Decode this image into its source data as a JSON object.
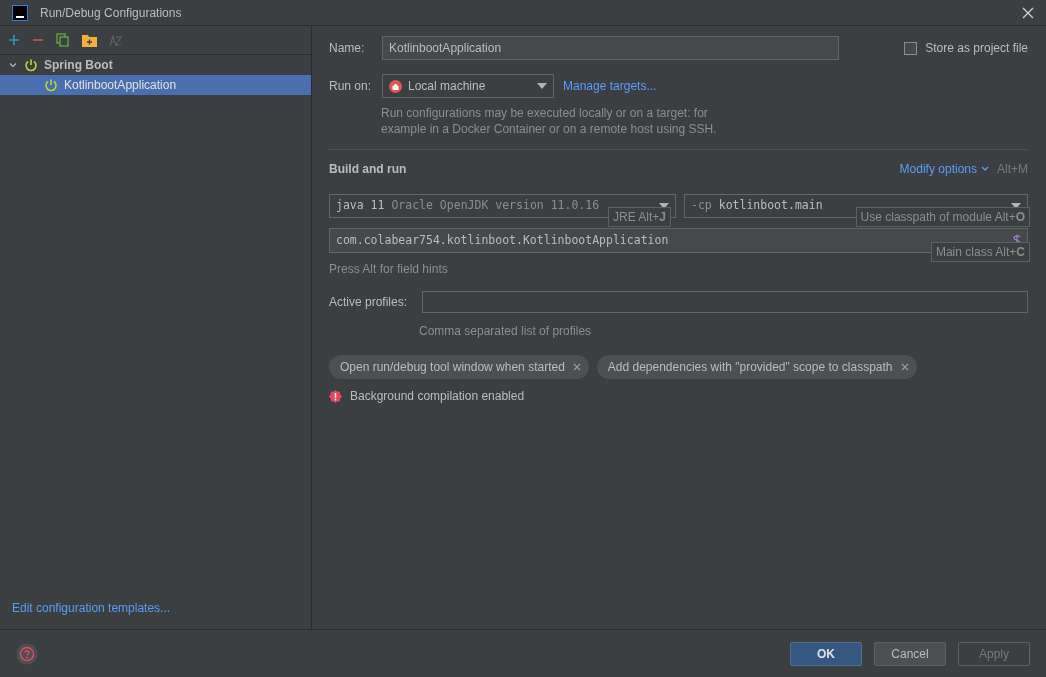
{
  "window": {
    "title": "Run/Debug Configurations"
  },
  "tree": [
    {
      "label": "Spring Boot",
      "expanded": true,
      "selected": false,
      "children": [
        {
          "label": "KotlinbootApplication",
          "selected": true
        }
      ]
    }
  ],
  "edit_templates_link": "Edit configuration templates...",
  "name": {
    "label": "Name:",
    "value": "KotlinbootApplication"
  },
  "store_as_project_file": {
    "label": "Store as project file",
    "checked": false
  },
  "run_on": {
    "label": "Run on:",
    "value": "Local machine",
    "link": "Manage targets..."
  },
  "run_on_help": "Run configurations may be executed locally or on a target: for example in a Docker Container or on a remote host using SSH.",
  "section_title": "Build and run",
  "modify_options": {
    "label": "Modify options",
    "shortcut": "Alt+M"
  },
  "jre": {
    "version": "java 11",
    "detail": "Oracle OpenJDK version 11.0.16",
    "hint": "JRE Alt+**J**"
  },
  "classpath": {
    "prefix": "-cp",
    "value": "kotlinboot.main",
    "hint": "Use classpath of module Alt+**O**"
  },
  "main_class": {
    "value": "com.colabear754.kotlinboot.KotlinbootApplication",
    "hint": "Main class Alt+**C**"
  },
  "field_hints_note": "Press Alt for field hints",
  "active_profiles": {
    "label": "Active profiles:",
    "help": "Comma separated list of profiles"
  },
  "chips": [
    {
      "label": "Open run/debug tool window when started"
    },
    {
      "label": "Add dependencies with \"provided\" scope to classpath"
    }
  ],
  "warning": "Background compilation enabled",
  "buttons": [
    {
      "label": "OK",
      "kind": "primary"
    },
    {
      "label": "Cancel",
      "kind": "normal"
    },
    {
      "label": "Apply",
      "kind": "disabled"
    }
  ]
}
